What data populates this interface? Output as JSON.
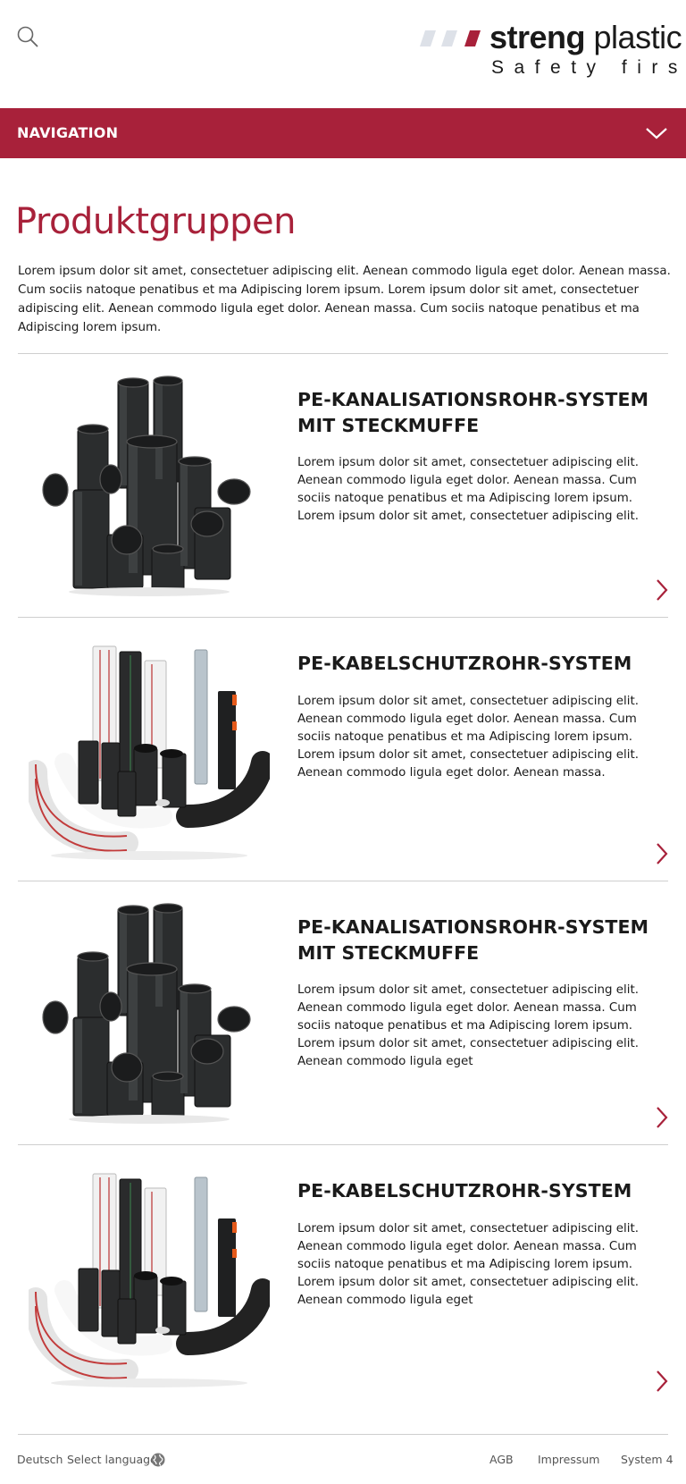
{
  "header": {
    "search_icon": "search-icon",
    "logo": {
      "name_bold": "streng",
      "name_light": " plastic",
      "tagline": "Safety first",
      "slash_colors": [
        "#dde1e8",
        "#dde1e8",
        "#a8213a"
      ]
    }
  },
  "nav": {
    "label": "NAVIGATION",
    "icon": "chevron-down-icon",
    "background": "#a8213a"
  },
  "intro": {
    "title": "Produktgruppen",
    "text": "Lorem ipsum dolor sit amet, consectetuer adipiscing elit. Aenean commodo ligula eget dolor. Aenean massa. Cum sociis natoque penatibus et ma Adipiscing lorem ipsum. Lorem ipsum dolor sit amet, consectetuer adipiscing elit. Aenean commodo ligula eget dolor. Aenean massa. Cum sociis natoque penatibus et ma Adipiscing lorem ipsum."
  },
  "products": [
    {
      "title_line1": "PE-KANALISATIONSROHR-SYSTEM",
      "title_line2": "MIT STECKMUFFE",
      "description": "Lorem ipsum dolor sit amet, consectetuer adipiscing elit. Aenean commodo ligula eget dolor. Aenean massa. Cum sociis natoque penatibus et ma Adipiscing lorem ipsum. Lorem ipsum dolor sit amet, consectetuer adipiscing elit.",
      "image": "black-sewer-pipe-fittings",
      "arrow_icon": "chevron-right-icon"
    },
    {
      "title_line1": "PE-KABELSCHUTZROHR-SYSTEM",
      "title_line2": "",
      "description": "Lorem ipsum dolor sit amet, consectetuer adipiscing elit. Aenean commodo ligula eget dolor. Aenean massa. Cum sociis natoque penatibus et ma Adipiscing lorem ipsum. Lorem ipsum dolor sit amet, consectetuer adipiscing elit. Aenean commodo ligula eget dolor. Aenean massa.",
      "image": "cable-protection-pipes",
      "arrow_icon": "chevron-right-icon"
    },
    {
      "title_line1": "PE-KANALISATIONSROHR-SYSTEM",
      "title_line2": "MIT STECKMUFFE",
      "description": "Lorem ipsum dolor sit amet, consectetuer adipiscing elit. Aenean commodo ligula eget dolor. Aenean massa. Cum sociis natoque penatibus et ma Adipiscing lorem ipsum. Lorem ipsum dolor sit amet, consectetuer adipiscing elit. Aenean commodo ligula eget",
      "image": "black-sewer-pipe-fittings",
      "arrow_icon": "chevron-right-icon"
    },
    {
      "title_line1": "PE-KABELSCHUTZROHR-SYSTEM",
      "title_line2": "",
      "description": "Lorem ipsum dolor sit amet, consectetuer adipiscing elit. Aenean commodo ligula eget dolor. Aenean massa. Cum sociis natoque penatibus et ma Adipiscing lorem ipsum. Lorem ipsum dolor sit amet, consectetuer adipiscing elit. Aenean commodo ligula eget",
      "image": "cable-protection-pipes",
      "arrow_icon": "chevron-right-icon"
    }
  ],
  "footer": {
    "language_current": "Deutsch",
    "language_select": "Select language",
    "language_icon": "globe-icon",
    "links": [
      "AGB",
      "Impressum",
      "System 4"
    ]
  },
  "colors": {
    "accent": "#a8213a",
    "text": "#1a1a1a",
    "divider": "#cfcfcf"
  }
}
